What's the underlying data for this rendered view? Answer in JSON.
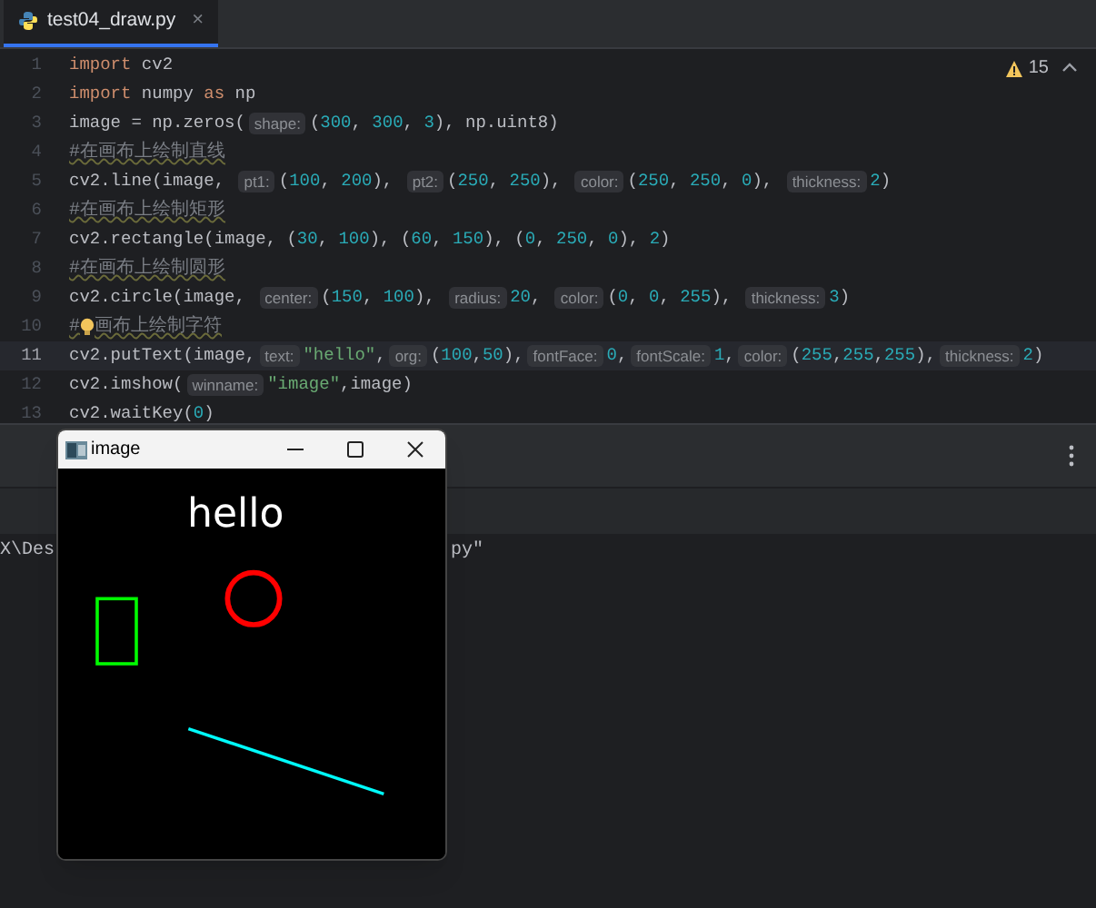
{
  "tabs": [
    {
      "label": "test04_draw.py",
      "close": "×",
      "selected": true
    }
  ],
  "inspections": {
    "count": "15"
  },
  "editor": {
    "lines": [
      {
        "number": "1",
        "tokens": [
          {
            "kind": "kw",
            "text": "import"
          },
          {
            "kind": "plain",
            "text": " cv2"
          }
        ]
      },
      {
        "number": "2",
        "tokens": [
          {
            "kind": "kw",
            "text": "import"
          },
          {
            "kind": "plain",
            "text": " numpy "
          },
          {
            "kind": "kw",
            "text": "as"
          },
          {
            "kind": "plain",
            "text": " np"
          }
        ]
      },
      {
        "number": "3",
        "tokens": [
          {
            "kind": "plain",
            "text": "image = np.zeros("
          },
          {
            "kind": "hint",
            "text": "shape:"
          },
          {
            "kind": "plain",
            "text": "("
          },
          {
            "kind": "num",
            "text": "300"
          },
          {
            "kind": "plain",
            "text": ", "
          },
          {
            "kind": "num",
            "text": "300"
          },
          {
            "kind": "plain",
            "text": ", "
          },
          {
            "kind": "num",
            "text": "3"
          },
          {
            "kind": "plain",
            "text": "), np.uint8)"
          }
        ]
      },
      {
        "number": "4",
        "tokens": [
          {
            "kind": "comment",
            "text": "#在画布上绘制直线"
          }
        ]
      },
      {
        "number": "5",
        "tokens": [
          {
            "kind": "plain",
            "text": "cv2.line(image, "
          },
          {
            "kind": "hint",
            "text": "pt1:"
          },
          {
            "kind": "plain",
            "text": "("
          },
          {
            "kind": "num",
            "text": "100"
          },
          {
            "kind": "plain",
            "text": ", "
          },
          {
            "kind": "num",
            "text": "200"
          },
          {
            "kind": "plain",
            "text": "), "
          },
          {
            "kind": "hint",
            "text": "pt2:"
          },
          {
            "kind": "plain",
            "text": "("
          },
          {
            "kind": "num",
            "text": "250"
          },
          {
            "kind": "plain",
            "text": ", "
          },
          {
            "kind": "num",
            "text": "250"
          },
          {
            "kind": "plain",
            "text": "), "
          },
          {
            "kind": "hint",
            "text": "color:"
          },
          {
            "kind": "plain",
            "text": "("
          },
          {
            "kind": "num",
            "text": "250"
          },
          {
            "kind": "plain",
            "text": ", "
          },
          {
            "kind": "num",
            "text": "250"
          },
          {
            "kind": "plain",
            "text": ", "
          },
          {
            "kind": "num",
            "text": "0"
          },
          {
            "kind": "plain",
            "text": "), "
          },
          {
            "kind": "hint",
            "text": "thickness:"
          },
          {
            "kind": "num",
            "text": "2"
          },
          {
            "kind": "plain",
            "text": ")"
          }
        ]
      },
      {
        "number": "6",
        "tokens": [
          {
            "kind": "comment",
            "text": "#在画布上绘制矩形"
          }
        ]
      },
      {
        "number": "7",
        "tokens": [
          {
            "kind": "plain",
            "text": "cv2.rectangle(image, ("
          },
          {
            "kind": "num",
            "text": "30"
          },
          {
            "kind": "plain",
            "text": ", "
          },
          {
            "kind": "num",
            "text": "100"
          },
          {
            "kind": "plain",
            "text": "), ("
          },
          {
            "kind": "num",
            "text": "60"
          },
          {
            "kind": "plain",
            "text": ", "
          },
          {
            "kind": "num",
            "text": "150"
          },
          {
            "kind": "plain",
            "text": "), ("
          },
          {
            "kind": "num",
            "text": "0"
          },
          {
            "kind": "plain",
            "text": ", "
          },
          {
            "kind": "num",
            "text": "250"
          },
          {
            "kind": "plain",
            "text": ", "
          },
          {
            "kind": "num",
            "text": "0"
          },
          {
            "kind": "plain",
            "text": "), "
          },
          {
            "kind": "num",
            "text": "2"
          },
          {
            "kind": "plain",
            "text": ")"
          }
        ]
      },
      {
        "number": "8",
        "tokens": [
          {
            "kind": "comment",
            "text": "#在画布上绘制圆形"
          }
        ]
      },
      {
        "number": "9",
        "tokens": [
          {
            "kind": "plain",
            "text": "cv2.circle(image, "
          },
          {
            "kind": "hint",
            "text": "center:"
          },
          {
            "kind": "plain",
            "text": "("
          },
          {
            "kind": "num",
            "text": "150"
          },
          {
            "kind": "plain",
            "text": ", "
          },
          {
            "kind": "num",
            "text": "100"
          },
          {
            "kind": "plain",
            "text": "), "
          },
          {
            "kind": "hint",
            "text": "radius:"
          },
          {
            "kind": "num",
            "text": "20"
          },
          {
            "kind": "plain",
            "text": ", "
          },
          {
            "kind": "hint",
            "text": "color:"
          },
          {
            "kind": "plain",
            "text": "("
          },
          {
            "kind": "num",
            "text": "0"
          },
          {
            "kind": "plain",
            "text": ", "
          },
          {
            "kind": "num",
            "text": "0"
          },
          {
            "kind": "plain",
            "text": ", "
          },
          {
            "kind": "num",
            "text": "255"
          },
          {
            "kind": "plain",
            "text": "), "
          },
          {
            "kind": "hint",
            "text": "thickness:"
          },
          {
            "kind": "num",
            "text": "3"
          },
          {
            "kind": "plain",
            "text": ")"
          }
        ]
      },
      {
        "number": "10",
        "tokens": [
          {
            "kind": "comment",
            "text": "#"
          },
          {
            "kind": "bulb"
          },
          {
            "kind": "comment",
            "text": "画布上绘制字符"
          }
        ]
      },
      {
        "number": "11",
        "current": true,
        "tokens": [
          {
            "kind": "plain",
            "text": "cv2.putText(image,"
          },
          {
            "kind": "hint",
            "text": "text:"
          },
          {
            "kind": "str",
            "text": "\"hello\""
          },
          {
            "kind": "plain",
            "text": ","
          },
          {
            "kind": "hint",
            "text": "org:"
          },
          {
            "kind": "plain",
            "text": "("
          },
          {
            "kind": "num",
            "text": "100"
          },
          {
            "kind": "plain",
            "text": ","
          },
          {
            "kind": "num",
            "text": "50"
          },
          {
            "kind": "plain",
            "text": "),"
          },
          {
            "kind": "hint",
            "text": "fontFace:"
          },
          {
            "kind": "num",
            "text": "0"
          },
          {
            "kind": "plain",
            "text": ","
          },
          {
            "kind": "hint",
            "text": "fontScale:"
          },
          {
            "kind": "num",
            "text": "1"
          },
          {
            "kind": "plain",
            "text": ","
          },
          {
            "kind": "hint",
            "text": "color:"
          },
          {
            "kind": "plain",
            "text": "("
          },
          {
            "kind": "num",
            "text": "255"
          },
          {
            "kind": "plain",
            "text": ","
          },
          {
            "kind": "num",
            "text": "255"
          },
          {
            "kind": "plain",
            "text": ","
          },
          {
            "kind": "num",
            "text": "255"
          },
          {
            "kind": "plain",
            "text": "),"
          },
          {
            "kind": "hint",
            "text": "thickness:"
          },
          {
            "kind": "num",
            "text": "2"
          },
          {
            "kind": "plain",
            "text": ")"
          }
        ]
      },
      {
        "number": "12",
        "tokens": [
          {
            "kind": "plain",
            "text": "cv2.imshow("
          },
          {
            "kind": "hint",
            "text": "winname:"
          },
          {
            "kind": "str",
            "text": "\"image\""
          },
          {
            "kind": "plain",
            "text": ",image)"
          }
        ]
      },
      {
        "number": "13",
        "tokens": [
          {
            "kind": "plain",
            "text": "cv2.waitKey("
          },
          {
            "kind": "num",
            "text": "0"
          },
          {
            "kind": "plain",
            "text": ")"
          }
        ]
      }
    ]
  },
  "console": {
    "left_text": "X\\Des",
    "right_text": "py\""
  },
  "image_window": {
    "title": "image",
    "canvas_text": "hello"
  }
}
